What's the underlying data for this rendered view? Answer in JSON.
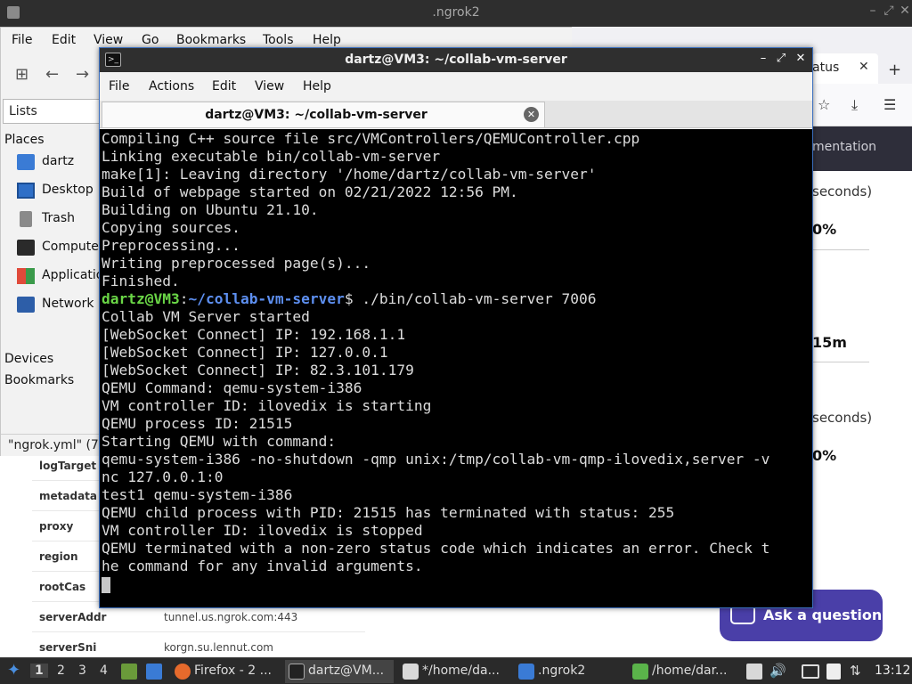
{
  "fm": {
    "title": ".ngrok2",
    "menu": [
      "File",
      "Edit",
      "View",
      "Go",
      "Bookmarks",
      "Tools",
      "Help"
    ],
    "lists_label": "Lists",
    "places_header": "Places",
    "places": [
      "dartz",
      "Desktop",
      "Trash",
      "Computer",
      "Applications",
      "Network"
    ],
    "devices_header": "Devices",
    "bookmarks_header": "Bookmarks",
    "status": "\"ngrok.yml\" (79"
  },
  "browser": {
    "tab_label": "atus",
    "doc_link": "mentation",
    "texts": [
      "seconds)",
      "0%",
      "15m",
      "seconds)",
      "0%"
    ],
    "ask_label": "Ask a question"
  },
  "config": {
    "rows": [
      {
        "key": "logTarget",
        "value": ""
      },
      {
        "key": "metadata",
        "value": ""
      },
      {
        "key": "proxy",
        "value": ""
      },
      {
        "key": "region",
        "value": ""
      },
      {
        "key": "rootCas",
        "value": ""
      },
      {
        "key": "serverAddr",
        "value": "tunnel.us.ngrok.com:443"
      },
      {
        "key": "serverSni",
        "value": "korgn.su.lennut.com"
      }
    ]
  },
  "terminal": {
    "title": "dartz@VM3: ~/collab-vm-server",
    "menu": [
      "File",
      "Actions",
      "Edit",
      "View",
      "Help"
    ],
    "tab_label": "dartz@VM3: ~/collab-vm-server",
    "prompt_user": "dartz@VM3",
    "prompt_sep": ":",
    "prompt_path": "~/collab-vm-server",
    "prompt_command": "$ ./bin/collab-vm-server 7006",
    "lines_before": [
      "Compiling C++ source file src/VMControllers/QEMUController.cpp",
      "Linking executable bin/collab-vm-server",
      "make[1]: Leaving directory '/home/dartz/collab-vm-server'",
      "Build of webpage started on 02/21/2022 12:56 PM.",
      "Building on Ubuntu 21.10.",
      "Copying sources.",
      "Preprocessing...",
      "Writing preprocessed page(s)...",
      "Finished."
    ],
    "lines_after": [
      "Collab VM Server started",
      "[WebSocket Connect] IP: 192.168.1.1",
      "[WebSocket Connect] IP: 127.0.0.1",
      "[WebSocket Connect] IP: 82.3.101.179",
      "QEMU Command: qemu-system-i386",
      "VM controller ID: ilovedix is starting",
      "QEMU process ID: 21515",
      "Starting QEMU with command:",
      "qemu-system-i386 -no-shutdown -qmp unix:/tmp/collab-vm-qmp-ilovedix,server -v",
      "nc 127.0.0.1:0",
      "test1 qemu-system-i386",
      "QEMU child process with PID: 21515 has terminated with status: 255",
      "VM controller ID: ilovedix is stopped",
      "QEMU terminated with a non-zero status code which indicates an error. Check t",
      "he command for any invalid arguments."
    ]
  },
  "taskbar": {
    "workspaces": [
      "1",
      "2",
      "3",
      "4"
    ],
    "tasks": [
      {
        "label": "Firefox - 2 ...",
        "icon": "firefox-icon",
        "color": "#e66a2c"
      },
      {
        "label": "dartz@VM...",
        "icon": "terminal-icon",
        "color": "#222222"
      },
      {
        "label": "*/home/da...",
        "icon": "text-editor-icon",
        "color": "#d8d8d8"
      },
      {
        "label": ".ngrok2",
        "icon": "folder-icon",
        "color": "#3a7bd5"
      },
      {
        "label": "/home/dar...",
        "icon": "text-editor-icon",
        "color": "#5ab34a"
      }
    ],
    "clock": "13:12"
  },
  "colors": {
    "terminal_bg": "#000000",
    "prompt_user": "#6ad646",
    "prompt_path": "#5d8ff0",
    "ask_button": "#4a3fa8"
  }
}
